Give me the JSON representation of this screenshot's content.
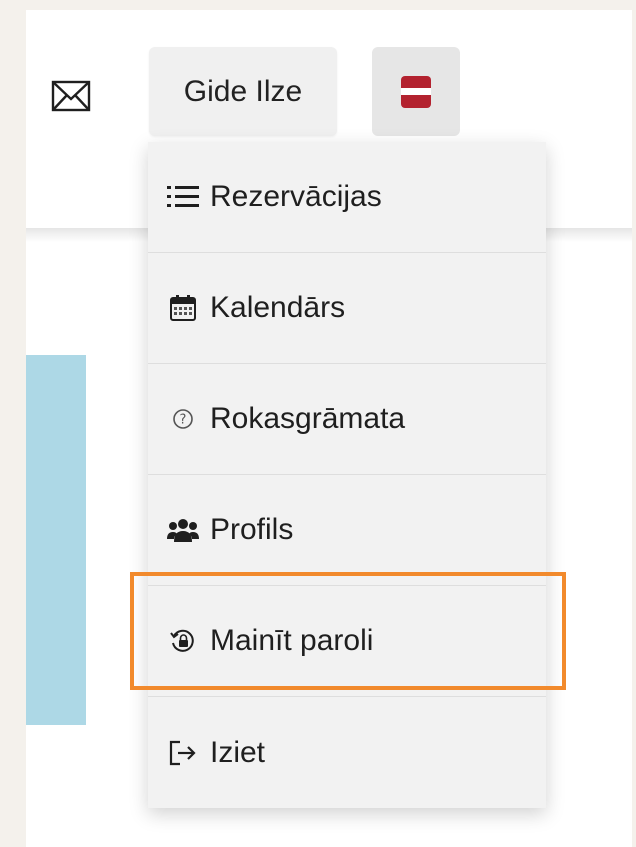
{
  "header": {
    "user_name": "Gide Ilze",
    "language_flag": "latvia-flag",
    "mail_icon": "envelope-icon"
  },
  "menu": {
    "items": [
      {
        "label": "Rezervācijas",
        "icon": "list-icon"
      },
      {
        "label": "Kalendārs",
        "icon": "calendar-icon"
      },
      {
        "label": "Rokasgrāmata",
        "icon": "help-circle-icon"
      },
      {
        "label": "Profils",
        "icon": "users-icon"
      },
      {
        "label": "Mainīt paroli",
        "icon": "password-reset-icon",
        "highlighted": true
      },
      {
        "label": "Iziet",
        "icon": "logout-icon"
      }
    ]
  },
  "colors": {
    "highlight": "#f28a2c",
    "panel": "#add8e6",
    "flag_red": "#b3222f"
  }
}
